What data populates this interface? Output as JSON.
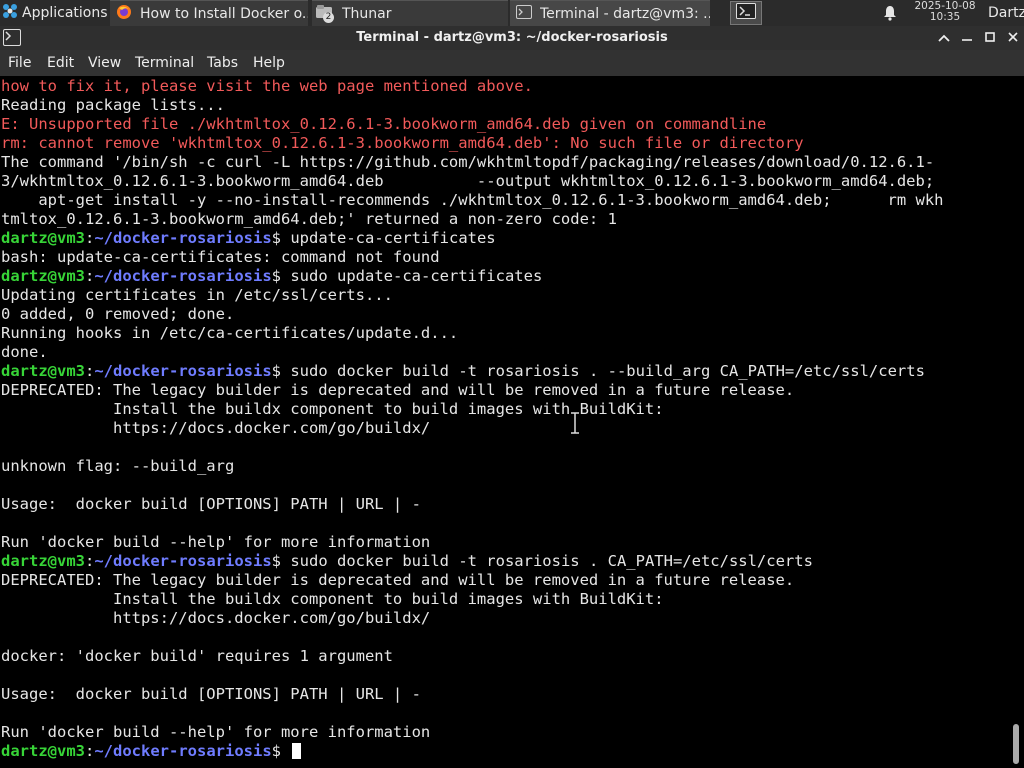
{
  "panel": {
    "apps_label": "Applications",
    "tasks": [
      {
        "label": "How to Install Docker o...",
        "icon": "firefox-icon"
      },
      {
        "label": "Thunar",
        "icon": "folder-icon",
        "badge": "2"
      },
      {
        "label": "Terminal - dartz@vm3: ...",
        "icon": "terminal-icon"
      }
    ],
    "clock_date": "2025-10-08",
    "clock_time": "10:35",
    "user": "Dartz"
  },
  "window": {
    "title": "Terminal - dartz@vm3: ~/docker-rosariosis"
  },
  "menu": [
    "File",
    "Edit",
    "View",
    "Terminal",
    "Tabs",
    "Help"
  ],
  "prompt": {
    "user_host": "dartz@vm3",
    "sep": ":",
    "path": "~/docker-rosariosis",
    "symbol": "$"
  },
  "terminal_lines": [
    {
      "type": "error",
      "text": "how to fix it, please visit the web page mentioned above."
    },
    {
      "type": "text",
      "text": "Reading package lists..."
    },
    {
      "type": "error",
      "text": "E: Unsupported file ./wkhtmltox_0.12.6.1-3.bookworm_amd64.deb given on commandline"
    },
    {
      "type": "error",
      "text": "rm: cannot remove 'wkhtmltox_0.12.6.1-3.bookworm_amd64.deb': No such file or directory"
    },
    {
      "type": "text",
      "text": "The command '/bin/sh -c curl -L https://github.com/wkhtmltopdf/packaging/releases/download/0.12.6.1-"
    },
    {
      "type": "text",
      "text": "3/wkhtmltox_0.12.6.1-3.bookworm_amd64.deb          --output wkhtmltox_0.12.6.1-3.bookworm_amd64.deb;"
    },
    {
      "type": "text",
      "text": "    apt-get install -y --no-install-recommends ./wkhtmltox_0.12.6.1-3.bookworm_amd64.deb;      rm wkh"
    },
    {
      "type": "text",
      "text": "tmltox_0.12.6.1-3.bookworm_amd64.deb;' returned a non-zero code: 1"
    },
    {
      "type": "prompt",
      "text": "update-ca-certificates"
    },
    {
      "type": "text",
      "text": "bash: update-ca-certificates: command not found"
    },
    {
      "type": "prompt",
      "text": "sudo update-ca-certificates"
    },
    {
      "type": "text",
      "text": "Updating certificates in /etc/ssl/certs..."
    },
    {
      "type": "text",
      "text": "0 added, 0 removed; done."
    },
    {
      "type": "text",
      "text": "Running hooks in /etc/ca-certificates/update.d..."
    },
    {
      "type": "text",
      "text": "done."
    },
    {
      "type": "prompt",
      "text": "sudo docker build -t rosariosis . --build_arg CA_PATH=/etc/ssl/certs"
    },
    {
      "type": "text",
      "text": "DEPRECATED: The legacy builder is deprecated and will be removed in a future release."
    },
    {
      "type": "text",
      "text": "            Install the buildx component to build images with BuildKit:"
    },
    {
      "type": "text",
      "text": "            https://docs.docker.com/go/buildx/"
    },
    {
      "type": "text",
      "text": ""
    },
    {
      "type": "text",
      "text": "unknown flag: --build_arg"
    },
    {
      "type": "text",
      "text": ""
    },
    {
      "type": "text",
      "text": "Usage:  docker build [OPTIONS] PATH | URL | -"
    },
    {
      "type": "text",
      "text": ""
    },
    {
      "type": "text",
      "text": "Run 'docker build --help' for more information"
    },
    {
      "type": "prompt",
      "text": "sudo docker build -t rosariosis . CA_PATH=/etc/ssl/certs"
    },
    {
      "type": "text",
      "text": "DEPRECATED: The legacy builder is deprecated and will be removed in a future release."
    },
    {
      "type": "text",
      "text": "            Install the buildx component to build images with BuildKit:"
    },
    {
      "type": "text",
      "text": "            https://docs.docker.com/go/buildx/"
    },
    {
      "type": "text",
      "text": ""
    },
    {
      "type": "text",
      "text": "docker: 'docker build' requires 1 argument"
    },
    {
      "type": "text",
      "text": ""
    },
    {
      "type": "text",
      "text": "Usage:  docker build [OPTIONS] PATH | URL | -"
    },
    {
      "type": "text",
      "text": ""
    },
    {
      "type": "text",
      "text": "Run 'docker build --help' for more information"
    },
    {
      "type": "prompt",
      "text": "",
      "cursor": true
    }
  ]
}
